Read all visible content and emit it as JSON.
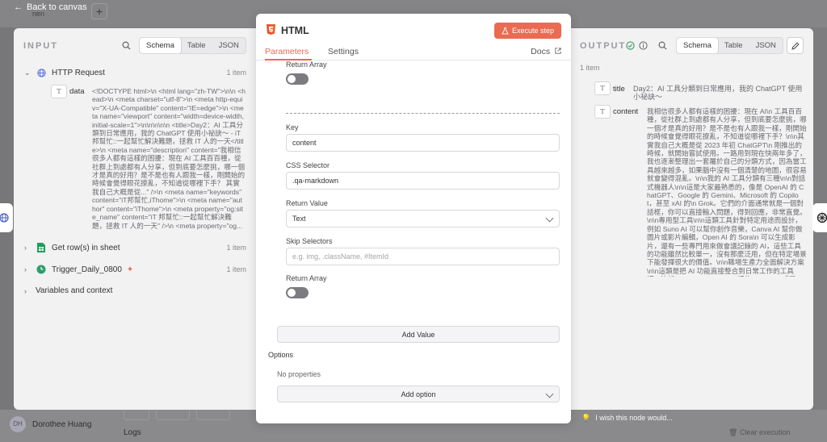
{
  "background": {
    "back_label": "Back to canvas",
    "tab_hint": "nen",
    "plus": "+",
    "user_initials": "DH",
    "user_name": "Dorothee Huang",
    "logs_label": "Logs",
    "clear_execution": "Clear execution",
    "wish_hint": "I wish this node would..."
  },
  "input_panel": {
    "title": "INPUT",
    "tabs": [
      "Schema",
      "Table",
      "JSON"
    ],
    "active_tab": "Schema",
    "nodes": [
      {
        "label": "HTTP Request",
        "count": "1 item",
        "expanded": true,
        "icon": "globe-icon"
      },
      {
        "label": "Get row(s) in sheet",
        "count": "1 item",
        "expanded": false,
        "icon": "sheet-icon"
      },
      {
        "label": "Trigger_Daily_0800",
        "count": "1 item",
        "expanded": false,
        "icon": "clock-icon",
        "badge": "✦"
      }
    ],
    "field_type": "T",
    "field_name": "data",
    "field_value": "<!DOCTYPE html>\\n <html lang=\"zh-TW\">\\n\\n <head>\\n <meta charset=\"utf-8\">\\n <meta http-equiv=\"X-UA-Compatible\" content=\"IE=edge\">\\n <meta name=\"viewport\" content=\"width=device-width, initial-scale=1\">\\n\\n\\n\\n\\n <title>Day2：AI 工具分類到日常應用，我的 ChatGPT 使用小祕訣～ - iT 邦幫忙::一起幫忙解決難題，拯救 IT 人的一天</title>\\n <meta name=\"description\" content=\"我相信很多人都有這樣的困擾：現在 AI 工具百百種，從社群上到處都有人分享，但到底要怎麼挑，哪一個才是真的好用？是不是也有人跟我一樣，剛開始的時候會覺得眼花撩亂，不知道從哪裡下手？ 其實我自己大概是從...\" />\\n <meta name=\"keywords\" content=\"iT邦幫忙,iThome\">\\n <meta name=\"author\" content=\"iThome\">\\n <meta property=\"og:site_name\" content=\"iT 邦幫忙::一起幫忙解決難題，拯救 IT 人的一天\" />\\n <meta property=\"og...",
    "variables_label": "Variables and context"
  },
  "modal": {
    "title": "HTML",
    "execute_label": "Execute step",
    "tabs": [
      "Parameters",
      "Settings"
    ],
    "active_tab": "Parameters",
    "docs_label": "Docs",
    "fields": {
      "return_array_top_label": "Return Array",
      "key_label": "Key",
      "key_value": "content",
      "css_selector_label": "CSS Selector",
      "css_selector_value": ".qa-markdown",
      "return_value_label": "Return Value",
      "return_value_value": "Text",
      "skip_selectors_label": "Skip Selectors",
      "skip_selectors_placeholder": "e.g. img, .className, #ItemId",
      "return_array_label": "Return Array"
    },
    "add_value_label": "Add Value",
    "options_label": "Options",
    "no_properties": "No properties",
    "add_option_label": "Add option"
  },
  "output_panel": {
    "title": "OUTPUT",
    "tabs": [
      "Schema",
      "Table",
      "JSON"
    ],
    "active_tab": "Schema",
    "count": "1 item",
    "fields": [
      {
        "type": "T",
        "name": "title",
        "value": "Day2：AI 工具分類到日常應用，我的 ChatGPT 使用小祕訣～"
      },
      {
        "type": "T",
        "name": "content",
        "value": "我相信很多人都有這樣的困擾：現在 AI\\n 工具百百種，從社群上到處都有人分享，但到底要怎麼挑，哪一個才是真的好用？是不是也有人跟我一樣，剛開始的時候會覺得眼花撩亂，不知道從哪裡下手？\\n\\n其實我自己大概是從 2023 年初 ChatGPT\\n 剛推出的時候，就開始嘗試使用。一路用到現在快兩年多了，我也逐漸整理出一套屬於自己的分類方式，因為當工具越來越多，如果腦中沒有一個清楚的地圖，很容易就會變得混亂。\\n\\n我的 AI 工具分類有三種\\n\\n對話式機器人\\n\\n這是大家最熟悉的，像是 OpenAI 的 ChatGPT、Google 的 Gemini、Microsoft 的 Copilot，甚至 xAI 的\\n Grok。它們的介面通常就是一個對話框，你可以直接輸入問題，得到回應，非常直覺。\\n\\n專用型工具\\n\\n這類工具針對特定用途而設計，例如 Suno AI 可以幫你創作音樂，Canva AI 幫你做圖片或影片編輯，Open AI 的 Sora\\n 可以生成影片，還有一些專門用來做會議記錄的 AI，這些工具的功能雖然比較單一，沒有那麼泛用，但在特定場景下能發揮很大的價值。\\n\\n職場生產力全面解決方案\\n\\n這類是把 AI 功能直接整合到日常工作的工具裡，比如 Google Workspace 裡的 Gemini，或是 Microsoft Office 的\\n Copilot，這些功能通常出現在我們每天使用的應用程式中，讓..."
      }
    ]
  },
  "colors": {
    "accent": "#ea6a52",
    "panel_bg": "#f2f2f3",
    "backdrop": "#7d7d7f"
  }
}
